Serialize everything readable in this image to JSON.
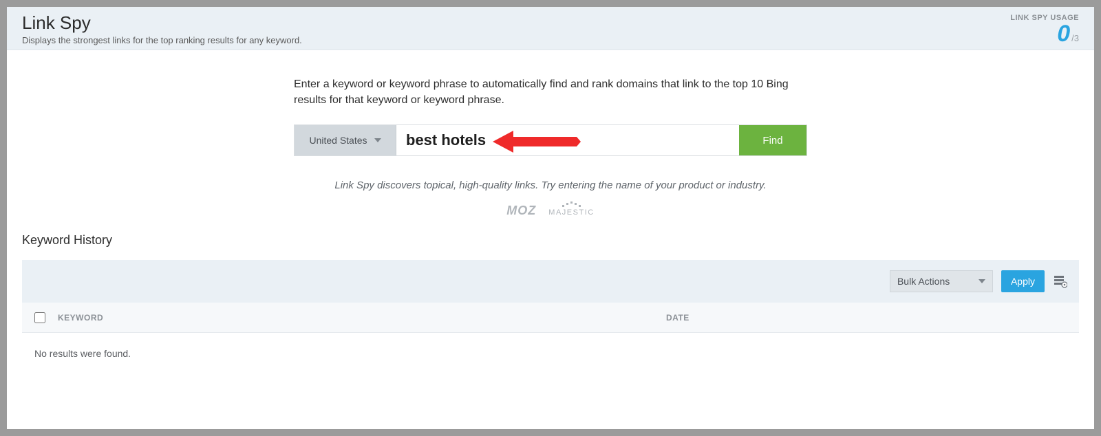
{
  "header": {
    "title": "Link Spy",
    "subtitle": "Displays the strongest links for the top ranking results for any keyword.",
    "usage_label": "LINK SPY USAGE",
    "usage_used": "0",
    "usage_total": "/3"
  },
  "search": {
    "instruction": "Enter a keyword or keyword phrase to automatically find and rank domains that link to the top 10 Bing results for that keyword or keyword phrase.",
    "country": "United States",
    "keyword_value": "best hotels",
    "find_label": "Find",
    "hint": "Link Spy discovers topical, high-quality links. Try entering the name of your product or industry."
  },
  "logos": {
    "moz": "MOZ",
    "majestic": "MAJESTIC"
  },
  "history": {
    "title": "Keyword History",
    "bulk_label": "Bulk Actions",
    "apply_label": "Apply",
    "col_keyword": "KEYWORD",
    "col_date": "DATE",
    "empty": "No results were found."
  },
  "colors": {
    "accent_blue": "#2aa4e0",
    "accent_green": "#6cb33f",
    "panel_bg": "#eaf0f5",
    "red_arrow": "#ef2a2a"
  }
}
